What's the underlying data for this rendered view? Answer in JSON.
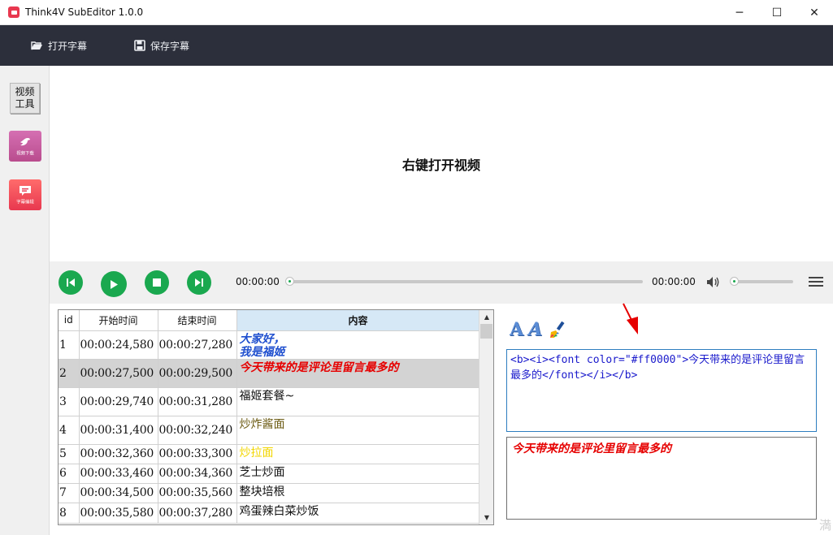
{
  "window": {
    "title": "Think4V SubEditor 1.0.0",
    "minimize": "─",
    "maximize": "☐",
    "close": "✕"
  },
  "toolbar": {
    "open_label": "打开字幕",
    "save_label": "保存字幕"
  },
  "sidebar": {
    "video_tools_label": "视频\n工具",
    "video_download_label": "视频下载",
    "subtitle_edit_label": "字幕编辑"
  },
  "video": {
    "hint": "右键打开视频"
  },
  "player": {
    "current_time": "00:00:00",
    "total_time": "00:00:00",
    "progress": 0,
    "volume": 0
  },
  "table": {
    "headers": [
      "id",
      "开始时间",
      "结束时间",
      "内容"
    ],
    "rows": [
      {
        "id": "1",
        "start": "00:00:24,580",
        "end": "00:00:27,280",
        "content": "大家好，\n我是福姬",
        "color": "#1f4fcf",
        "bold": true,
        "italic": true
      },
      {
        "id": "2",
        "start": "00:00:27,500",
        "end": "00:00:29,500",
        "content": "今天带来的是评论里留言最多的",
        "color": "#e60000",
        "bold": true,
        "italic": true
      },
      {
        "id": "3",
        "start": "00:00:29,740",
        "end": "00:00:31,280",
        "content": "福姬套餐~",
        "color": "#111111",
        "bold": false,
        "italic": false
      },
      {
        "id": "4",
        "start": "00:00:31,400",
        "end": "00:00:32,240",
        "content": "炒炸酱面",
        "color": "#6b5a12",
        "bold": false,
        "italic": false
      },
      {
        "id": "5",
        "start": "00:00:32,360",
        "end": "00:00:33,300",
        "content": "炒拉面",
        "color": "#f2d600",
        "bold": false,
        "italic": false
      },
      {
        "id": "6",
        "start": "00:00:33,460",
        "end": "00:00:34,360",
        "content": "芝士炒面",
        "color": "#111111",
        "bold": false,
        "italic": false
      },
      {
        "id": "7",
        "start": "00:00:34,500",
        "end": "00:00:35,560",
        "content": "整块培根",
        "color": "#111111",
        "bold": false,
        "italic": false
      },
      {
        "id": "8",
        "start": "00:00:35,580",
        "end": "00:00:37,280",
        "content": "鸡蛋辣白菜炒饭",
        "color": "#111111",
        "bold": false,
        "italic": false
      }
    ],
    "selected_row": 1
  },
  "editor": {
    "code": "<b><i><font color=\"#ff0000\">今天带来的是评论里留言最多的</font></i></b>",
    "preview": "今天带来的是评论里留言最多的",
    "preview_color": "#e60000"
  },
  "watermark": "満"
}
